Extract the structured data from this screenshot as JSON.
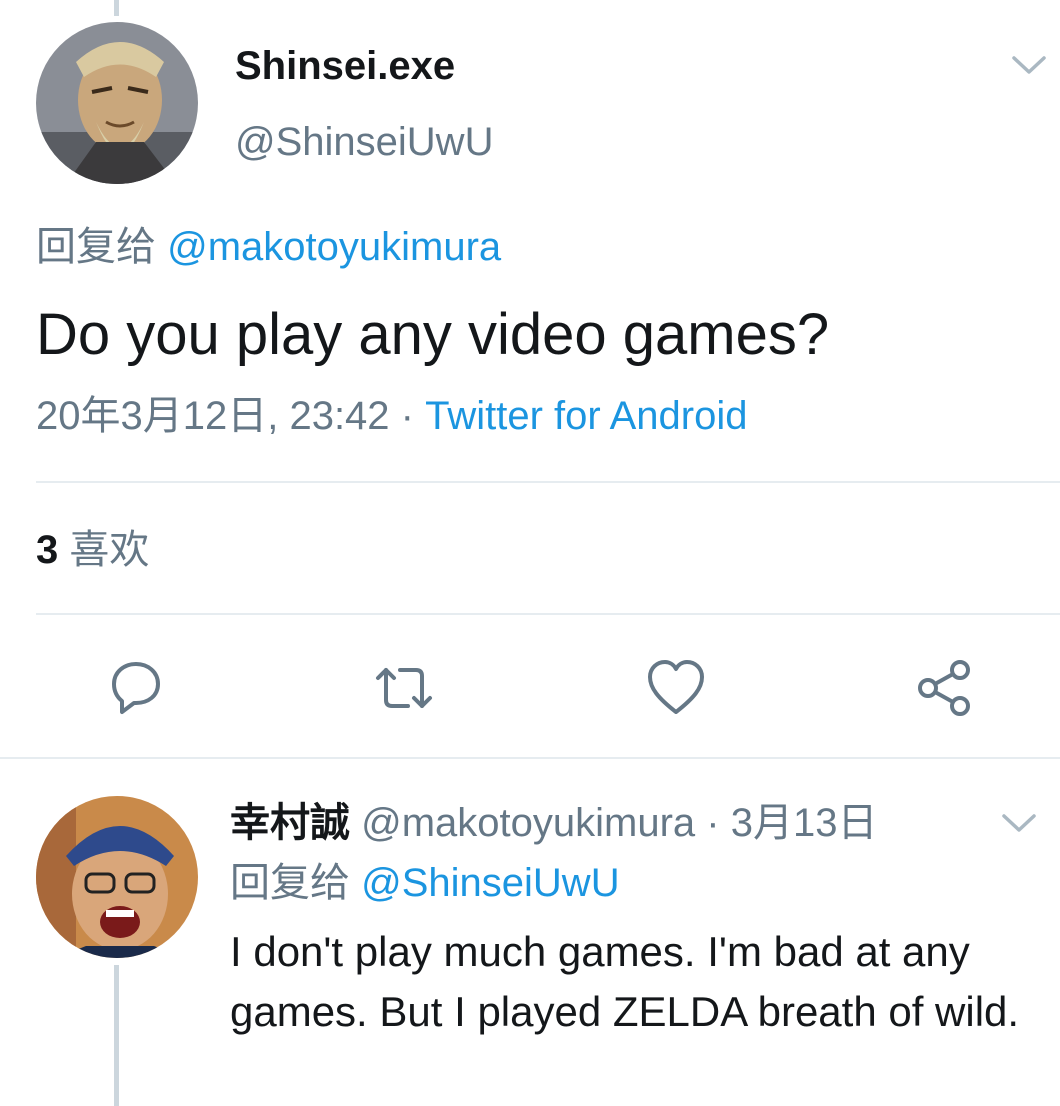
{
  "main_tweet": {
    "display_name": "Shinsei.exe",
    "handle": "@ShinseiUwU",
    "reply_prefix": "回复给",
    "reply_mention": "@makotoyukimura",
    "text": "Do you play any video games?",
    "timestamp": "20年3月12日, 23:42",
    "separator": " · ",
    "source": "Twitter for Android",
    "likes_count": "3",
    "likes_label": "喜欢"
  },
  "actions": {
    "reply_icon": "reply-icon",
    "retweet_icon": "retweet-icon",
    "like_icon": "heart-icon",
    "share_icon": "share-icon"
  },
  "reply_tweet": {
    "display_name": "幸村誠",
    "handle": "@makotoyukimura",
    "separator": " · ",
    "date": "3月13日",
    "reply_prefix": "回复给",
    "reply_mention": "@ShinseiUwU",
    "text": "I don't play much games. I'm bad at any games. But I played ZELDA breath of wild."
  },
  "colors": {
    "accent": "#1b95e0",
    "secondary_text": "#657786",
    "divider": "#e6ecf0",
    "thread_line": "#ccd6dd"
  }
}
